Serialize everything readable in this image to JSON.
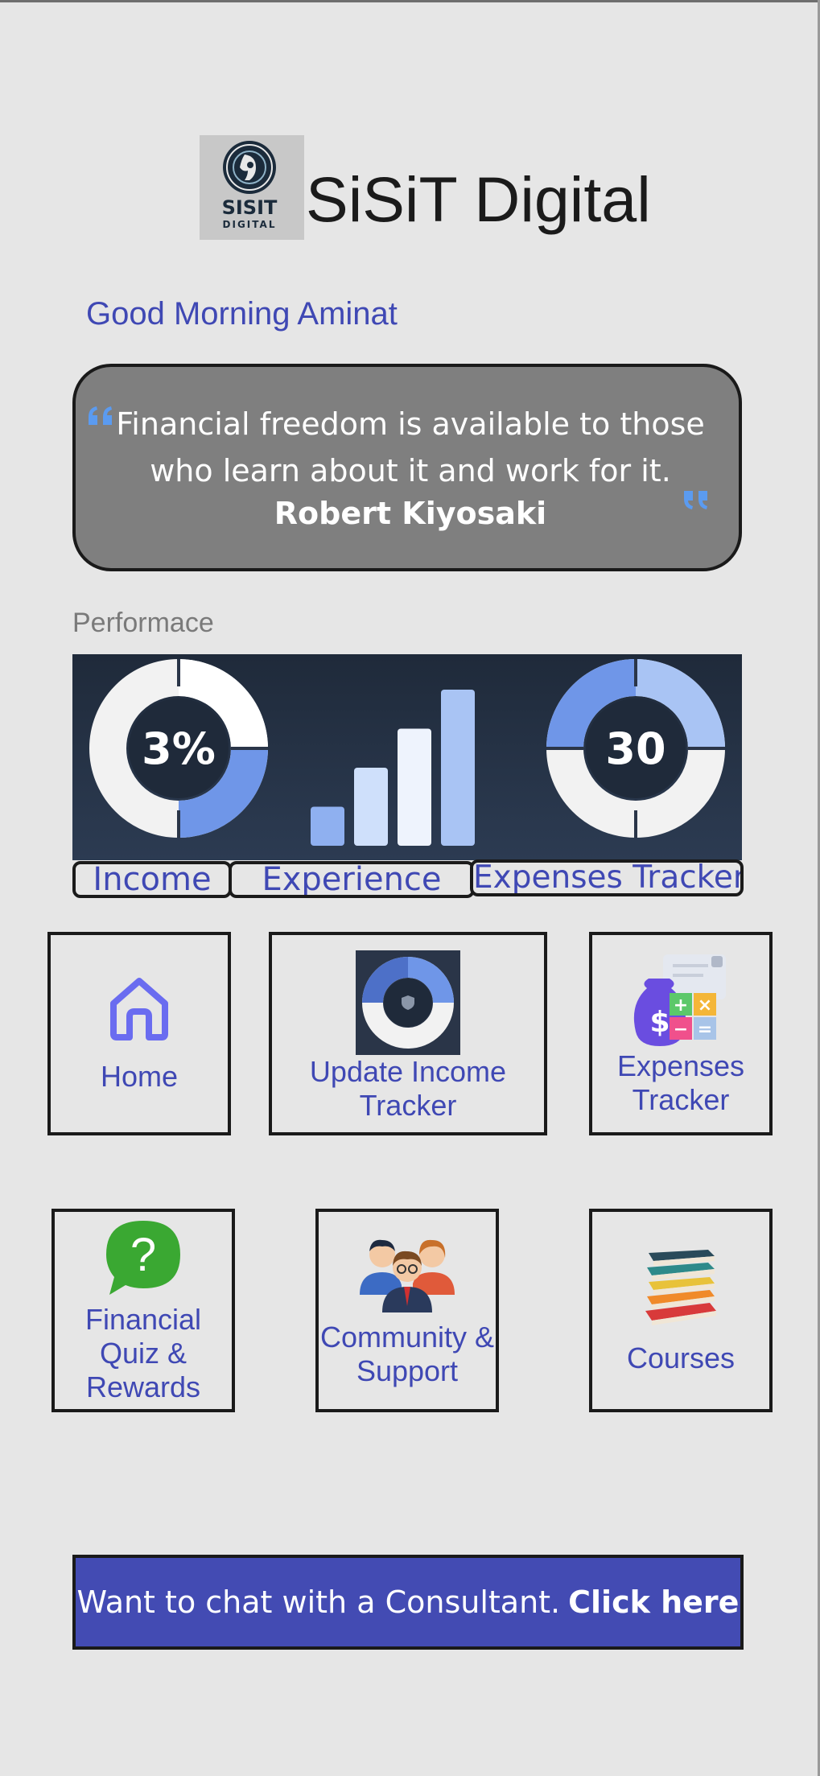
{
  "header": {
    "app_title": "SiSiT Digital",
    "logo_text_line1": "SISIT",
    "logo_text_line2": "DIGITAL"
  },
  "greeting": "Good Morning Aminat",
  "quote": {
    "text": "Financial freedom is available to those who learn about it and work for it.",
    "author": "Robert Kiyosaki"
  },
  "performance": {
    "section_label": "Performace",
    "left_gauge_text": "3%",
    "right_gauge_text": "30",
    "bars_fill_fractions": [
      0.25,
      0.5,
      0.75,
      1.0
    ],
    "tabs": {
      "income": "Income",
      "experience": "Experience",
      "expenses_tracker": "Expenses Tracker"
    }
  },
  "tiles": {
    "home": "Home",
    "update_income_tracker": "Update Income Tracker",
    "expenses_tracker": "Expenses Tracker",
    "financial_quiz": "Financial Quiz & Rewards",
    "community_support": "Community & Support",
    "courses": "Courses"
  },
  "cta": {
    "text": "Want to chat with a Consultant.",
    "link": "Click here"
  },
  "colors": {
    "accent": "#3f48b4",
    "cta_bg": "#434bb3",
    "quote_bg": "#7f7f7f",
    "background": "#e6e6e6"
  },
  "icons": {
    "home": "home-icon",
    "update_income": "donut-chart-icon",
    "expenses": "money-bag-calculator-icon",
    "quiz": "question-bubble-icon",
    "community": "people-group-icon",
    "courses": "books-stack-icon"
  }
}
